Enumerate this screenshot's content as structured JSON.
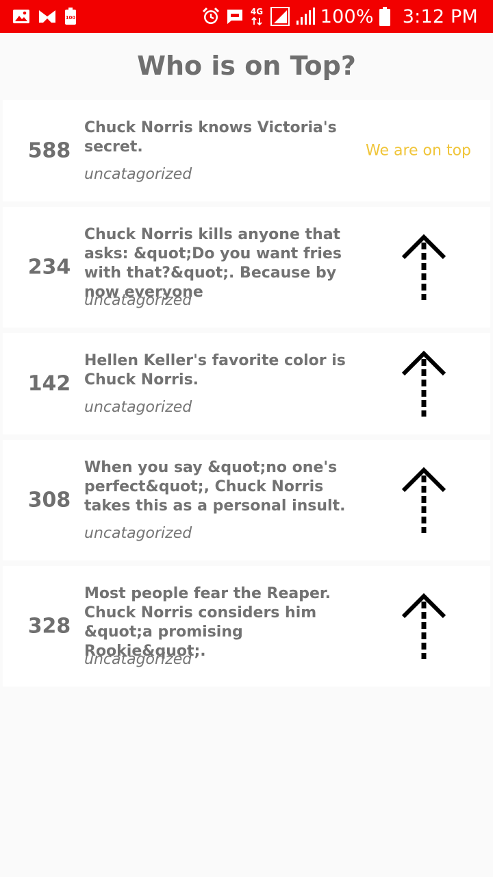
{
  "status_bar": {
    "icons_left": [
      "image-icon",
      "mail-app-icon",
      "battery-saver-icon"
    ],
    "icons_right": [
      "alarm-icon",
      "message-icon",
      "network-4g-icon",
      "sim-signal-icon",
      "cell-signal-icon",
      "battery-icon"
    ],
    "network_label": "4G",
    "battery_percent": "100%",
    "time": "3:12 PM",
    "color": "#f20000"
  },
  "header": {
    "title": "Who is on Top?"
  },
  "top_label": "We are on top",
  "jokes": [
    {
      "score": "588",
      "text": "Chuck Norris knows Victoria's secret.",
      "category": "uncatagorized",
      "on_top": true
    },
    {
      "score": "234",
      "text": "Chuck Norris kills anyone that asks: &quot;Do you want fries with that?&quot;. Because by now everyone",
      "category": "uncatagorized",
      "on_top": false
    },
    {
      "score": "142",
      "text": "Hellen Keller's favorite color is Chuck Norris.",
      "category": "uncatagorized",
      "on_top": false
    },
    {
      "score": "308",
      "text": "When you say &quot;no one's perfect&quot;, Chuck Norris takes this as a personal insult.",
      "category": "uncatagorized",
      "on_top": false
    },
    {
      "score": "328",
      "text": "Most people fear the Reaper. Chuck Norris considers him &quot;a promising Rookie&quot;.",
      "category": "uncatagorized",
      "on_top": false
    }
  ],
  "colors": {
    "accent_yellow": "#f0c53a",
    "text_gray": "#727272",
    "card_bg": "#ffffff",
    "page_bg": "#fafafa"
  }
}
